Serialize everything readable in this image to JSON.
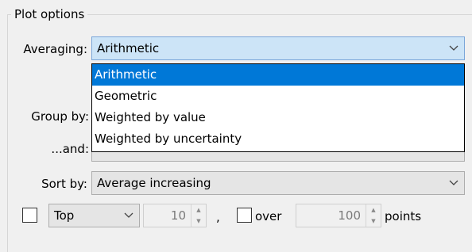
{
  "group_title": "Plot options",
  "averaging": {
    "label": "Averaging:",
    "value": "Arithmetic",
    "options": [
      "Arithmetic",
      "Geometric",
      "Weighted by value",
      "Weighted by uncertainty"
    ]
  },
  "group_by": {
    "label": "Group by:"
  },
  "and_by": {
    "label": "...and:"
  },
  "sort_by": {
    "label": "Sort by:",
    "value": "Average increasing"
  },
  "limit": {
    "top_value": "Top",
    "count": "10",
    "separator": ",",
    "over_label": "over",
    "over_count": "100",
    "points_label": "points"
  },
  "icons": {
    "chevron": "chevron-down-icon",
    "spin": "spin-arrows-icon"
  }
}
